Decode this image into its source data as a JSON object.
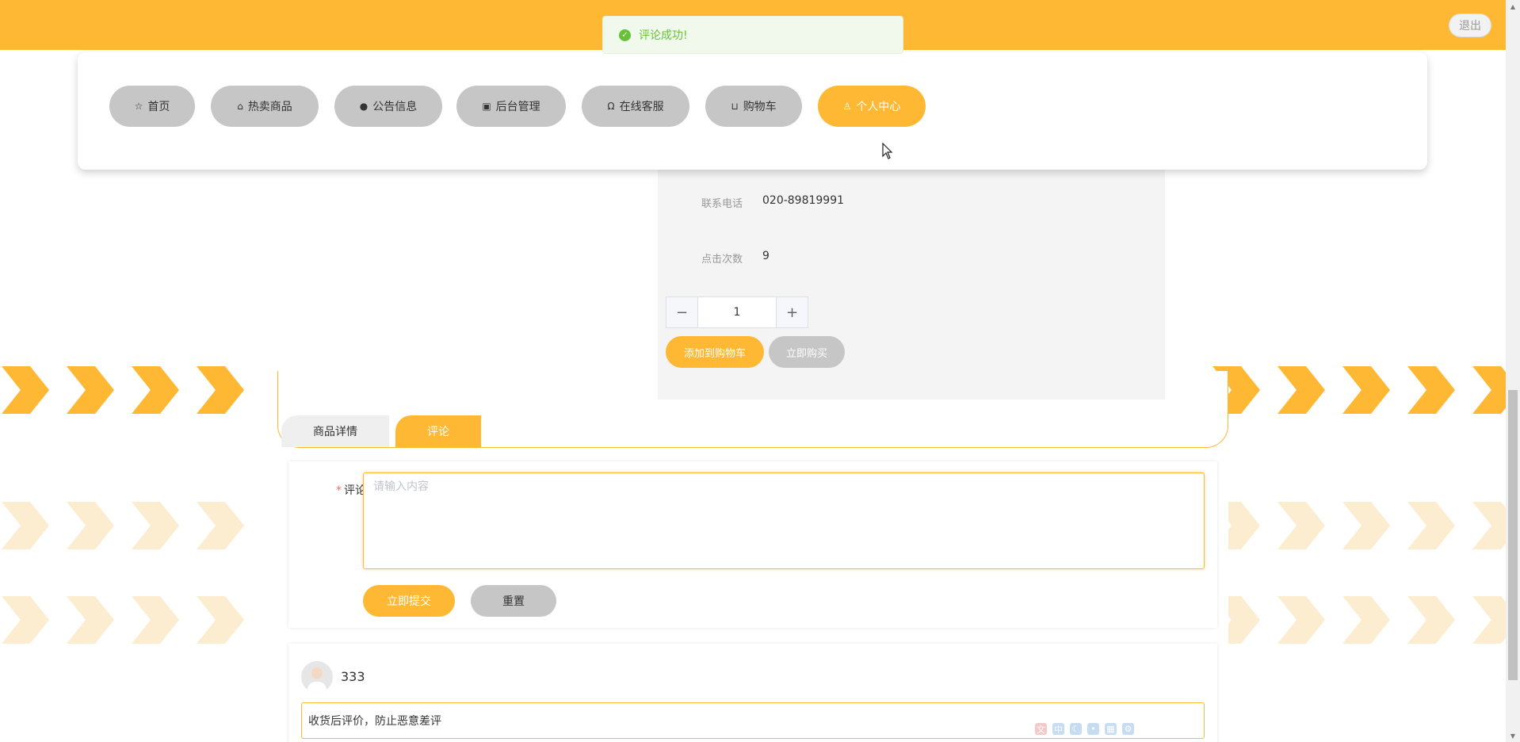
{
  "header": {
    "logout_label": "退出"
  },
  "toast": {
    "message": "评论成功!",
    "icon": "check-circle-icon",
    "color": "#67c23a"
  },
  "nav": {
    "items": [
      {
        "label": "首页",
        "icon": "star-icon"
      },
      {
        "label": "热卖商品",
        "icon": "bag-icon"
      },
      {
        "label": "公告信息",
        "icon": "alert-icon"
      },
      {
        "label": "后台管理",
        "icon": "briefcase-icon"
      },
      {
        "label": "在线客服",
        "icon": "headset-icon"
      },
      {
        "label": "购物车",
        "icon": "cart-icon"
      },
      {
        "label": "个人中心",
        "icon": "user-icon",
        "active": true
      }
    ]
  },
  "product": {
    "phone_label": "联系电话",
    "phone_value": "020-89819991",
    "clicks_label": "点击次数",
    "clicks_value": "9",
    "quantity": "1",
    "minus_label": "−",
    "plus_label": "+",
    "add_to_cart": "添加到购物车",
    "buy_now": "立即购买"
  },
  "tabs": {
    "details": "商品详情",
    "comments": "评论"
  },
  "comment_form": {
    "label": "评论",
    "required_mark": "*",
    "placeholder": "请输入内容",
    "submit": "立即提交",
    "reset": "重置"
  },
  "comments": [
    {
      "user": "333",
      "text": "收货后评价，防止恶意差评"
    }
  ],
  "colors": {
    "accent": "#ffb833",
    "inactive_button": "#c6c6c6",
    "chevron_light": "#fdedd0"
  }
}
